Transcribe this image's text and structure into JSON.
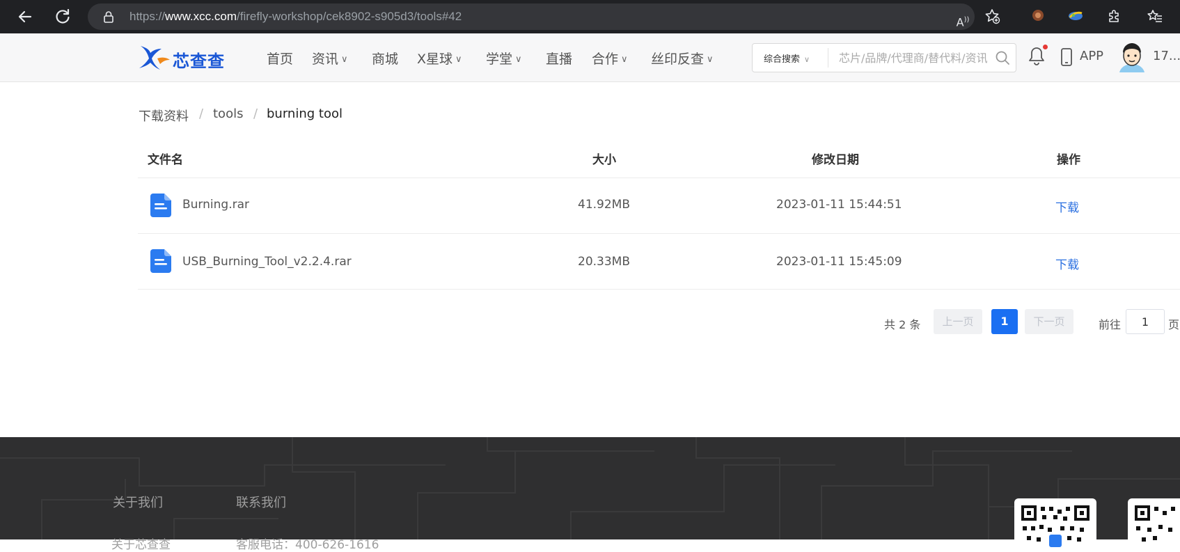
{
  "browser": {
    "url_prefix": "https://",
    "url_host": "www.xcc.com",
    "url_path": "/firefly-workshop/cek8902-s905d3/tools#42"
  },
  "header": {
    "logo_text": "芯查查",
    "menu": [
      {
        "label": "首页",
        "has_dropdown": false
      },
      {
        "label": "资讯",
        "has_dropdown": true
      },
      {
        "label": "商城",
        "has_dropdown": false
      },
      {
        "label": "X星球",
        "has_dropdown": true
      },
      {
        "label": "学堂",
        "has_dropdown": true
      },
      {
        "label": "直播",
        "has_dropdown": false
      },
      {
        "label": "合作",
        "has_dropdown": true
      },
      {
        "label": "丝印反查",
        "has_dropdown": true
      }
    ],
    "search_type": "综合搜索",
    "search_placeholder": "芯片/品牌/代理商/替代料/资讯",
    "app_label": "APP",
    "user_name": "17..."
  },
  "breadcrumb": [
    "下载资料",
    "tools",
    "burning tool"
  ],
  "table": {
    "columns": [
      "文件名",
      "大小",
      "修改日期",
      "操作"
    ],
    "rows": [
      {
        "name": "Burning.rar",
        "size": "41.92MB",
        "date": "2023-01-11 15:44:51",
        "action": "下载"
      },
      {
        "name": "USB_Burning_Tool_v2.2.4.rar",
        "size": "20.33MB",
        "date": "2023-01-11 15:45:09",
        "action": "下载"
      }
    ]
  },
  "pagination": {
    "total": "共 2 条",
    "prev": "上一页",
    "current": "1",
    "next": "下一页",
    "goto_label": "前往",
    "goto_value": "1",
    "page_suffix": "页"
  },
  "footer": {
    "links": [
      "关于我们",
      "联系我们"
    ],
    "texts": [
      "关于芯查查",
      "客服电话：400-626-1616"
    ]
  },
  "colors": {
    "accent": "#1a6ff2",
    "link": "#2a6fe0",
    "footer_bg": "#2f2f30"
  }
}
